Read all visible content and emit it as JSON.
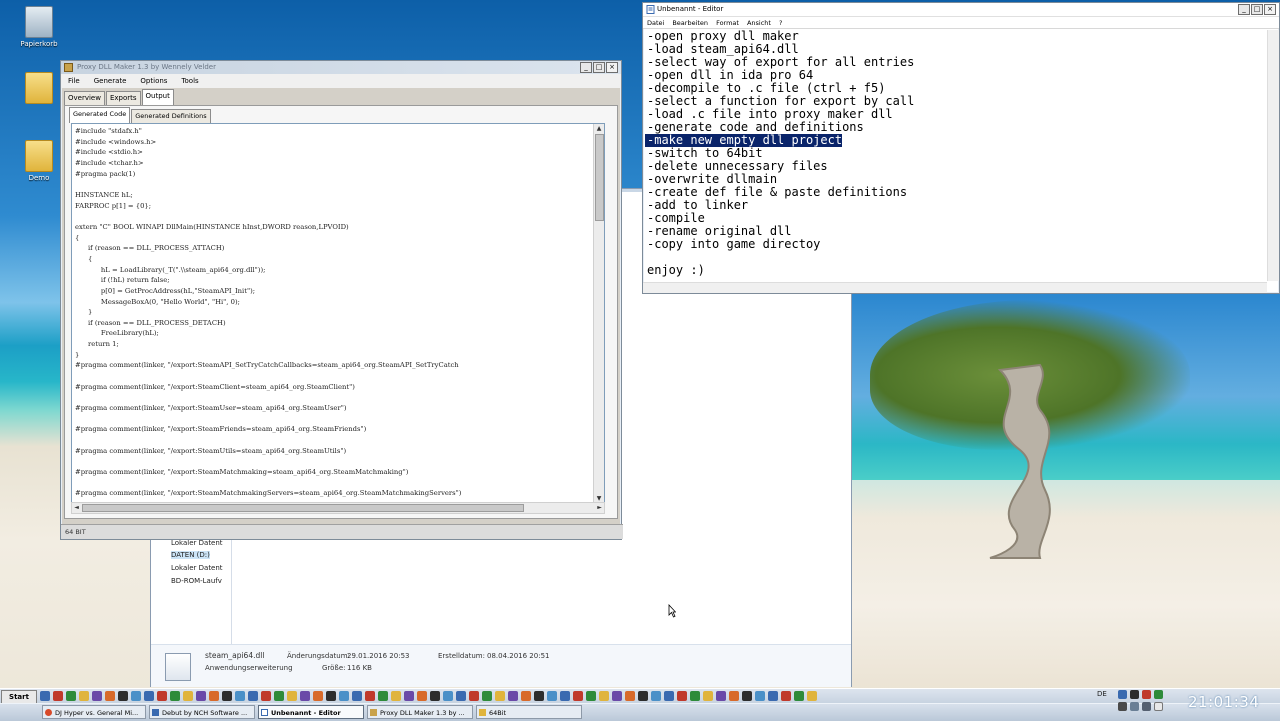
{
  "desktop": {
    "icons": [
      {
        "label": "Papierkorb",
        "glyph": "recycle-bin-icon"
      },
      {
        "label": "",
        "glyph": "folder-icon"
      },
      {
        "label": "Demo",
        "glyph": "folder-icon"
      }
    ]
  },
  "explorer": {
    "tree": [
      {
        "label": "Lokaler Datent"
      },
      {
        "label": "DATEN (D:)"
      },
      {
        "label": "Lokaler Datent"
      },
      {
        "label": "BD-ROM-Laufv"
      }
    ],
    "details": {
      "filename": "steam_api64.dll",
      "type": "Anwendungserweiterung",
      "modified_label": "Änderungsdatum:",
      "modified": "29.01.2016 20:53",
      "size_label": "Größe:",
      "size": "116 KB",
      "created_label": "Erstelldatum:",
      "created": "08.04.2016 20:51"
    }
  },
  "proxy_maker": {
    "title": "Proxy DLL Maker 1.3 by Wennely Velder",
    "menu": [
      "File",
      "Generate",
      "Options",
      "Tools"
    ],
    "tabs": [
      "Overview",
      "Exports",
      "Output"
    ],
    "subtabs": [
      "Generated Code",
      "Generated Definitions"
    ],
    "code": "#include \"stdafx.h\"\n#include <windows.h>\n#include <stdio.h>\n#include <tchar.h>\n#pragma pack(1)\n\nHINSTANCE hL;\nFARPROC p[1] = {0};\n\nextern \"C\" BOOL WINAPI DllMain(HINSTANCE hInst,DWORD reason,LPVOID)\n{\n      if (reason == DLL_PROCESS_ATTACH)\n      {\n            hL = LoadLibrary(_T(\".\\\\steam_api64_org.dll\"));\n            if (!hL) return false;\n            p[0] = GetProcAddress(hL,\"SteamAPI_Init\");\n            MessageBoxA(0, \"Hello World\", \"Hi\", 0);\n      }\n      if (reason == DLL_PROCESS_DETACH)\n            FreeLibrary(hL);\n      return 1;\n}\n#pragma comment(linker, \"/export:SteamAPI_SetTryCatchCallbacks=steam_api64_org.SteamAPI_SetTryCatch\n\n#pragma comment(linker, \"/export:SteamClient=steam_api64_org.SteamClient\")\n\n#pragma comment(linker, \"/export:SteamUser=steam_api64_org.SteamUser\")\n\n#pragma comment(linker, \"/export:SteamFriends=steam_api64_org.SteamFriends\")\n\n#pragma comment(linker, \"/export:SteamUtils=steam_api64_org.SteamUtils\")\n\n#pragma comment(linker, \"/export:SteamMatchmaking=steam_api64_org.SteamMatchmaking\")\n\n#pragma comment(linker, \"/export:SteamMatchmakingServers=steam_api64_org.SteamMatchmakingServers\")",
    "status": "64 BIT"
  },
  "editor": {
    "title": "Unbenannt - Editor",
    "menu": [
      "Datei",
      "Bearbeiten",
      "Format",
      "Ansicht",
      "?"
    ],
    "lines": [
      "-open proxy dll maker",
      "-load steam_api64.dll",
      "-select way of export for all entries",
      "-open dll in ida pro 64",
      "-decompile to .c file (ctrl + f5)",
      "-select a function for export by call",
      "-load .c file into proxy maker dll",
      "-generate code and definitions",
      "-make new empty dll project",
      "-switch to 64bit",
      "-delete unnecessary files",
      "-overwrite dllmain",
      "-create def file & paste definitions",
      "-add to linker",
      "-compile",
      "-rename original dll",
      "-copy into game directoy",
      "",
      "enjoy :)"
    ],
    "highlighted_line": 8
  },
  "taskbar": {
    "start": "Start",
    "buttons": [
      {
        "label": "DJ Hyper vs. General Mi..."
      },
      {
        "label": "Debut by NCH Software ..."
      },
      {
        "label": "Unbenannt - Editor"
      },
      {
        "label": "Proxy DLL Maker 1.3 by ..."
      },
      {
        "label": "64Bit"
      }
    ],
    "active_index": 2,
    "language": "DE",
    "clock": "21:01:34"
  }
}
